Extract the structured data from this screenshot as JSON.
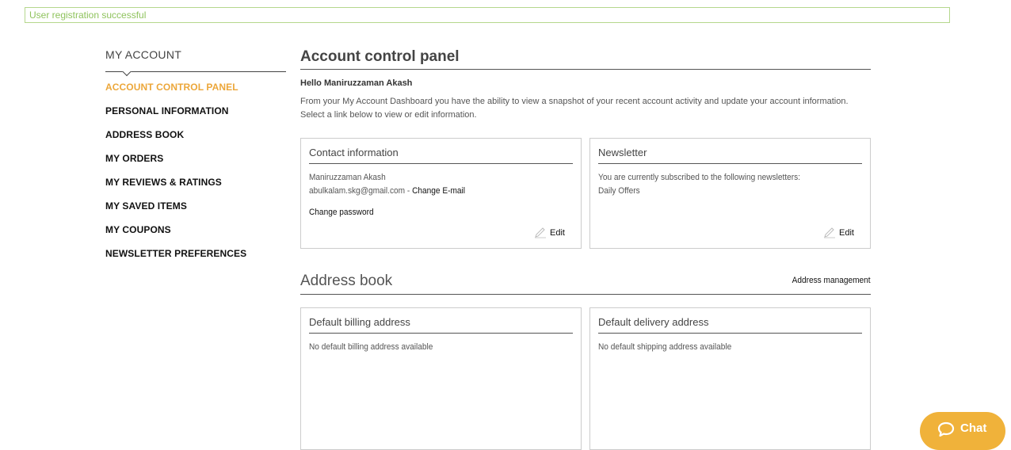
{
  "alert": {
    "text": "User registration successful"
  },
  "sidebar": {
    "title": "MY ACCOUNT",
    "items": [
      {
        "label": "ACCOUNT CONTROL PANEL",
        "active": true
      },
      {
        "label": "PERSONAL INFORMATION"
      },
      {
        "label": "ADDRESS BOOK"
      },
      {
        "label": "MY ORDERS"
      },
      {
        "label": "MY REVIEWS & RATINGS"
      },
      {
        "label": "MY SAVED ITEMS"
      },
      {
        "label": "MY COUPONS"
      },
      {
        "label": "NEWSLETTER PREFERENCES"
      }
    ]
  },
  "main": {
    "title": "Account control panel",
    "greeting": "Hello Maniruzzaman Akash",
    "intro": "From your My Account Dashboard you have the ability to view a snapshot of your recent account activity and update your account information. Select a link below to view or edit information.",
    "contact": {
      "title": "Contact information",
      "name": "Maniruzzaman Akash",
      "email": "abulkalam.skg@gmail.com",
      "separator": " - ",
      "change_email": "Change E-mail",
      "change_password": "Change password",
      "edit": "Edit"
    },
    "newsletter": {
      "title": "Newsletter",
      "line1": "You are currently subscribed to the following newsletters:",
      "line2": "Daily Offers",
      "edit": "Edit"
    },
    "address_book": {
      "title": "Address book",
      "link": "Address management",
      "billing": {
        "title": "Default billing address",
        "text": "No default billing address available"
      },
      "delivery": {
        "title": "Default delivery address",
        "text": "No default shipping address available"
      }
    }
  },
  "chat": {
    "label": "Chat",
    "icon": "chat-bubble-icon"
  },
  "colors": {
    "accent": "#eca73a",
    "success": "#8fc35d",
    "chat_bg": "#f0b23a"
  }
}
